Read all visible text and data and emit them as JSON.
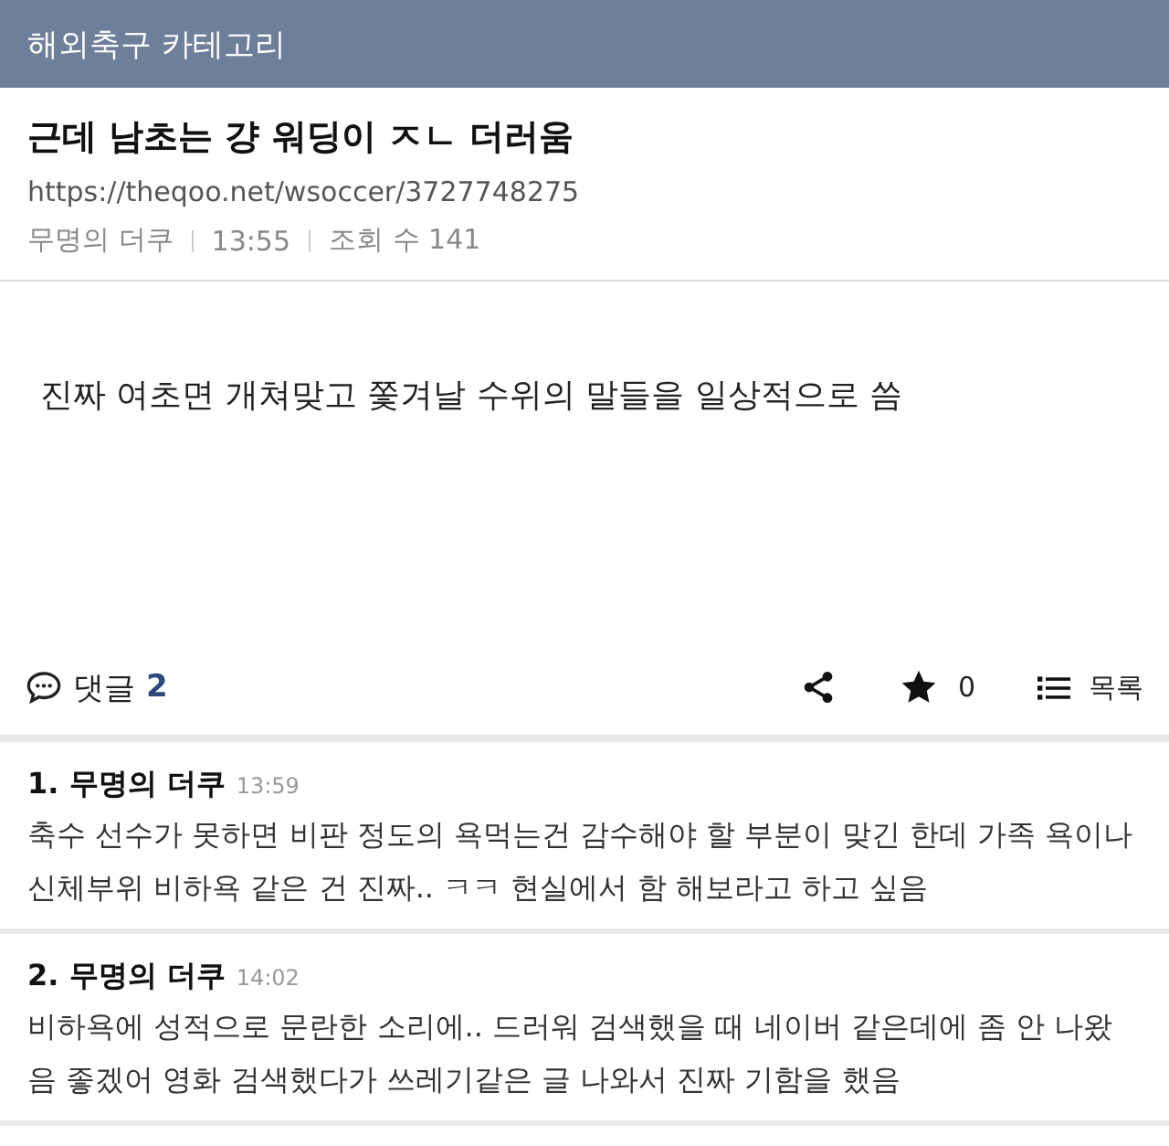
{
  "header": {
    "title": "해외축구 카테고리"
  },
  "post": {
    "title": "근데 남초는 걍 워딩이 ㅈㄴ 더러움",
    "url": "https://theqoo.net/wsoccer/3727748275",
    "author": "무명의 더쿠",
    "time": "13:55",
    "views": "조회 수 141",
    "body": "진짜 여초면 개쳐맞고 쫓겨날 수위의 말들을 일상적으로 씀"
  },
  "actions": {
    "comments_label": "댓글",
    "comments_count": "2",
    "stars_count": "0",
    "list_label": "목록"
  },
  "comments": [
    {
      "number": "1.",
      "author": "무명의 더쿠",
      "time": "13:59",
      "text": "축수 선수가 못하면 비판 정도의 욕먹는건 감수해야 할 부분이 맞긴 한데 가족 욕이나 신체부위 비하욕 같은 건 진짜.. ㅋㅋ 현실에서 함 해보라고 하고 싶음"
    },
    {
      "number": "2.",
      "author": "무명의 더쿠",
      "time": "14:02",
      "text": "비하욕에 성적으로 문란한 소리에.. 드러워 검색했을 때 네이버 같은데에 좀 안 나왔음 좋겠어 영화 검색했다가 쓰레기같은 글 나와서 진짜 기함을 했음"
    }
  ]
}
